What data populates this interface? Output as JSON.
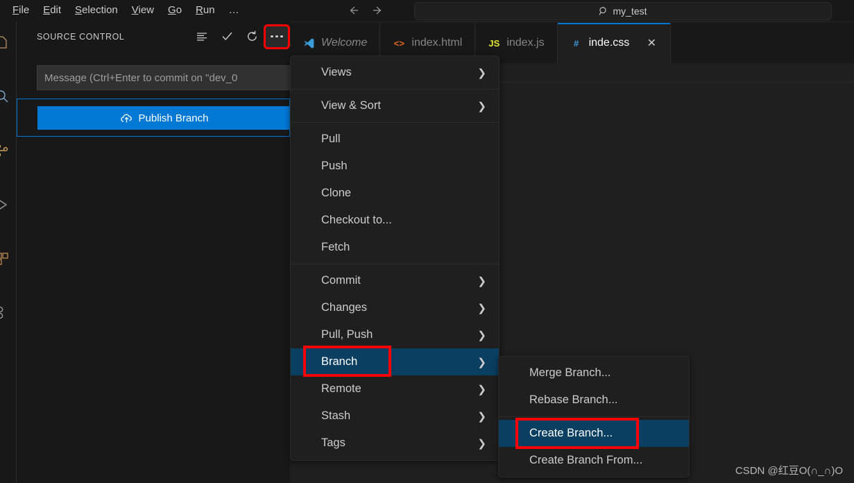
{
  "window": {
    "background": "#1f1f1f",
    "accent": "#0078d4",
    "selection_color": "#0a3f62",
    "highlight_box_color": "#ff0000"
  },
  "menubar": {
    "items": [
      {
        "label": "File",
        "mnemonic": "F",
        "rest": "ile"
      },
      {
        "label": "Edit",
        "mnemonic": "E",
        "rest": "dit"
      },
      {
        "label": "Selection",
        "mnemonic": "S",
        "rest": "election"
      },
      {
        "label": "View",
        "mnemonic": "V",
        "rest": "iew"
      },
      {
        "label": "Go",
        "mnemonic": "G",
        "rest": "o"
      },
      {
        "label": "Run",
        "mnemonic": "R",
        "rest": "un"
      }
    ],
    "more_label": "…"
  },
  "navigation": {
    "back_icon": "arrow-left-icon",
    "forward_icon": "arrow-right-icon"
  },
  "command_center": {
    "icon": "search-icon",
    "text": "my_test"
  },
  "activity_bar": {
    "items": [
      {
        "icon": "files-explorer-icon"
      },
      {
        "icon": "search-icon"
      },
      {
        "icon": "source-control-icon"
      },
      {
        "icon": "run-debug-icon"
      },
      {
        "icon": "extensions-icon"
      },
      {
        "icon": "remote-explorer-icon"
      }
    ]
  },
  "source_control": {
    "title": "SOURCE CONTROL",
    "actions": [
      {
        "name": "view-as-list-icon",
        "label": "View as List"
      },
      {
        "name": "commit-check-icon",
        "label": "Commit"
      },
      {
        "name": "refresh-icon",
        "label": "Refresh"
      },
      {
        "name": "more-actions-icon",
        "label": "Views and More Actions..."
      }
    ],
    "commit_placeholder": "Message (Ctrl+Enter to commit on \"dev_0",
    "publish_button": "Publish Branch",
    "publish_icon": "cloud-upload-icon"
  },
  "tabs": [
    {
      "label": "Welcome",
      "icon": "vscode-logo-icon",
      "icon_text": "",
      "icon_color": "#3b9dd8",
      "active": false,
      "italic": true,
      "closable": false
    },
    {
      "label": "index.html",
      "icon": "html-icon",
      "icon_text": "<>",
      "icon_color": "#e8681f",
      "active": false,
      "italic": false,
      "closable": false
    },
    {
      "label": "index.js",
      "icon": "js-icon",
      "icon_text": "JS",
      "icon_color": "#e5e52b",
      "active": false,
      "italic": false,
      "closable": false
    },
    {
      "label": "inde.css",
      "icon": "css-icon",
      "icon_text": "#",
      "icon_color": "#3b9dd8",
      "active": true,
      "italic": false,
      "closable": true,
      "close_label": "✕"
    }
  ],
  "context_menu": {
    "groups": [
      {
        "items": [
          {
            "label": "Views",
            "submenu": true,
            "selected": false
          }
        ]
      },
      {
        "items": [
          {
            "label": "View & Sort",
            "submenu": true,
            "selected": false
          }
        ]
      },
      {
        "items": [
          {
            "label": "Pull",
            "submenu": false,
            "selected": false
          },
          {
            "label": "Push",
            "submenu": false,
            "selected": false
          },
          {
            "label": "Clone",
            "submenu": false,
            "selected": false
          },
          {
            "label": "Checkout to...",
            "submenu": false,
            "selected": false
          },
          {
            "label": "Fetch",
            "submenu": false,
            "selected": false
          }
        ]
      },
      {
        "items": [
          {
            "label": "Commit",
            "submenu": true,
            "selected": false
          },
          {
            "label": "Changes",
            "submenu": true,
            "selected": false
          },
          {
            "label": "Pull, Push",
            "submenu": true,
            "selected": false
          },
          {
            "label": "Branch",
            "submenu": true,
            "selected": true,
            "highlighted": true
          },
          {
            "label": "Remote",
            "submenu": true,
            "selected": false
          },
          {
            "label": "Stash",
            "submenu": true,
            "selected": false
          },
          {
            "label": "Tags",
            "submenu": true,
            "selected": false
          }
        ]
      }
    ],
    "chevron": "❯"
  },
  "submenu": {
    "groups": [
      {
        "items": [
          {
            "label": "Merge Branch...",
            "selected": false
          },
          {
            "label": "Rebase Branch...",
            "selected": false
          }
        ]
      },
      {
        "items": [
          {
            "label": "Create Branch...",
            "selected": true,
            "highlighted": true
          },
          {
            "label": "Create Branch From...",
            "selected": false
          }
        ]
      }
    ]
  },
  "watermark": {
    "text": "CSDN @红豆O(∩_∩)O"
  }
}
